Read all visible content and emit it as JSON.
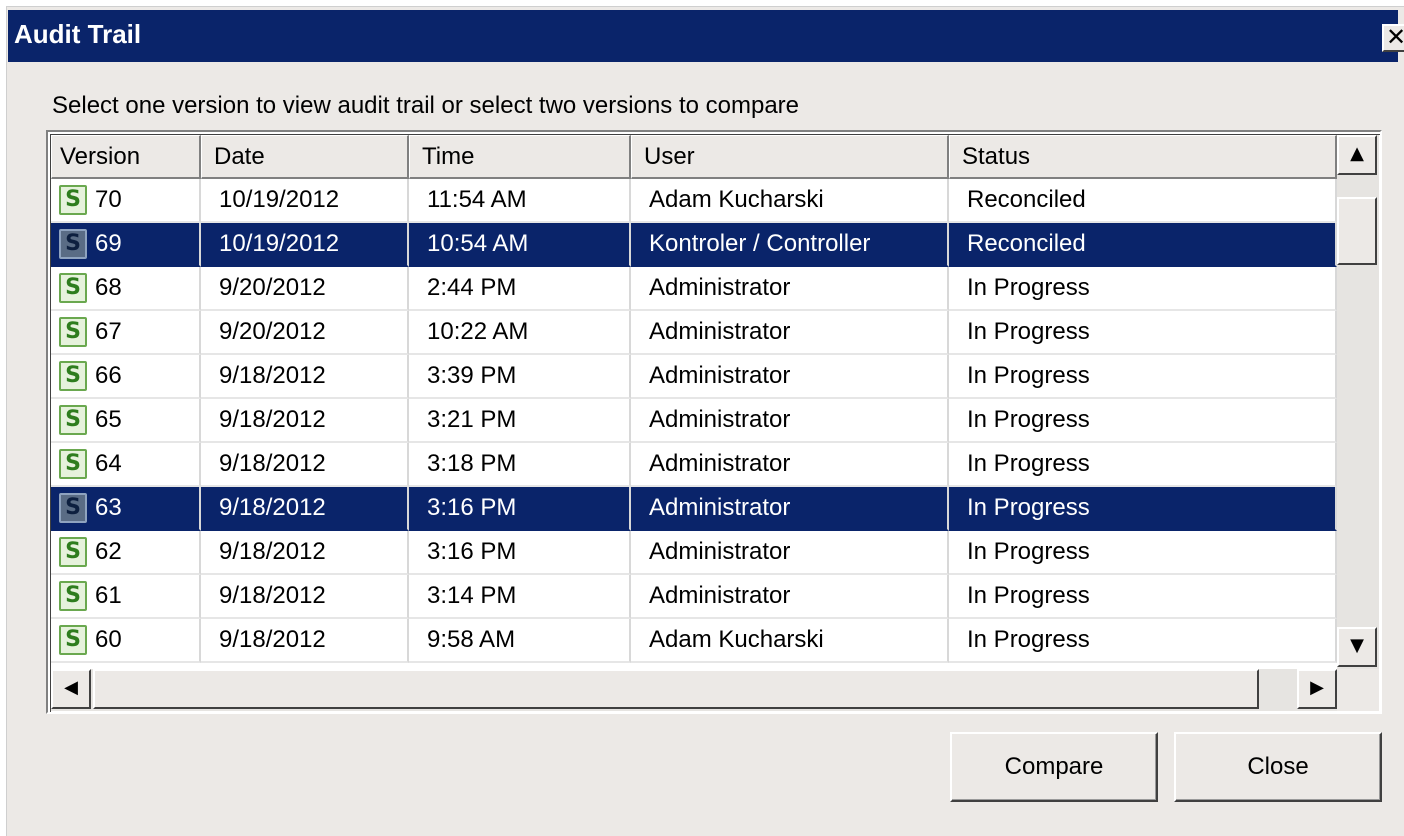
{
  "window": {
    "title": "Audit Trail",
    "close_glyph": "✕"
  },
  "instruction": "Select one version to view audit trail or select two versions to compare",
  "table": {
    "columns": [
      "Version",
      "Date",
      "Time",
      "User",
      "Status"
    ],
    "icon": "spreadsheet-s-icon",
    "icon_letter": "S",
    "rows": [
      {
        "version": "70",
        "date": "10/19/2012",
        "time": "11:54 AM",
        "user": "Adam Kucharski",
        "status": "Reconciled",
        "selected": false
      },
      {
        "version": "69",
        "date": "10/19/2012",
        "time": "10:54 AM",
        "user": "Kontroler / Controller",
        "status": "Reconciled",
        "selected": true
      },
      {
        "version": "68",
        "date": "9/20/2012",
        "time": "2:44 PM",
        "user": "Administrator",
        "status": "In Progress",
        "selected": false
      },
      {
        "version": "67",
        "date": "9/20/2012",
        "time": "10:22 AM",
        "user": "Administrator",
        "status": "In Progress",
        "selected": false
      },
      {
        "version": "66",
        "date": "9/18/2012",
        "time": "3:39 PM",
        "user": "Administrator",
        "status": "In Progress",
        "selected": false
      },
      {
        "version": "65",
        "date": "9/18/2012",
        "time": "3:21 PM",
        "user": "Administrator",
        "status": "In Progress",
        "selected": false
      },
      {
        "version": "64",
        "date": "9/18/2012",
        "time": "3:18 PM",
        "user": "Administrator",
        "status": "In Progress",
        "selected": false
      },
      {
        "version": "63",
        "date": "9/18/2012",
        "time": "3:16 PM",
        "user": "Administrator",
        "status": "In Progress",
        "selected": true
      },
      {
        "version": "62",
        "date": "9/18/2012",
        "time": "3:16 PM",
        "user": "Administrator",
        "status": "In Progress",
        "selected": false
      },
      {
        "version": "61",
        "date": "9/18/2012",
        "time": "3:14 PM",
        "user": "Administrator",
        "status": "In Progress",
        "selected": false
      },
      {
        "version": "60",
        "date": "9/18/2012",
        "time": "9:58 AM",
        "user": "Adam Kucharski",
        "status": "In Progress",
        "selected": false
      }
    ]
  },
  "scrollbar": {
    "up": "▲",
    "down": "▼",
    "left": "◀",
    "right": "▶"
  },
  "buttons": {
    "compare": "Compare",
    "close": "Close"
  },
  "colors": {
    "titlebar": "#0a246a",
    "selection": "#0a246a",
    "dialog_bg": "#ece9e6",
    "icon_green": "#2e7d1e"
  }
}
